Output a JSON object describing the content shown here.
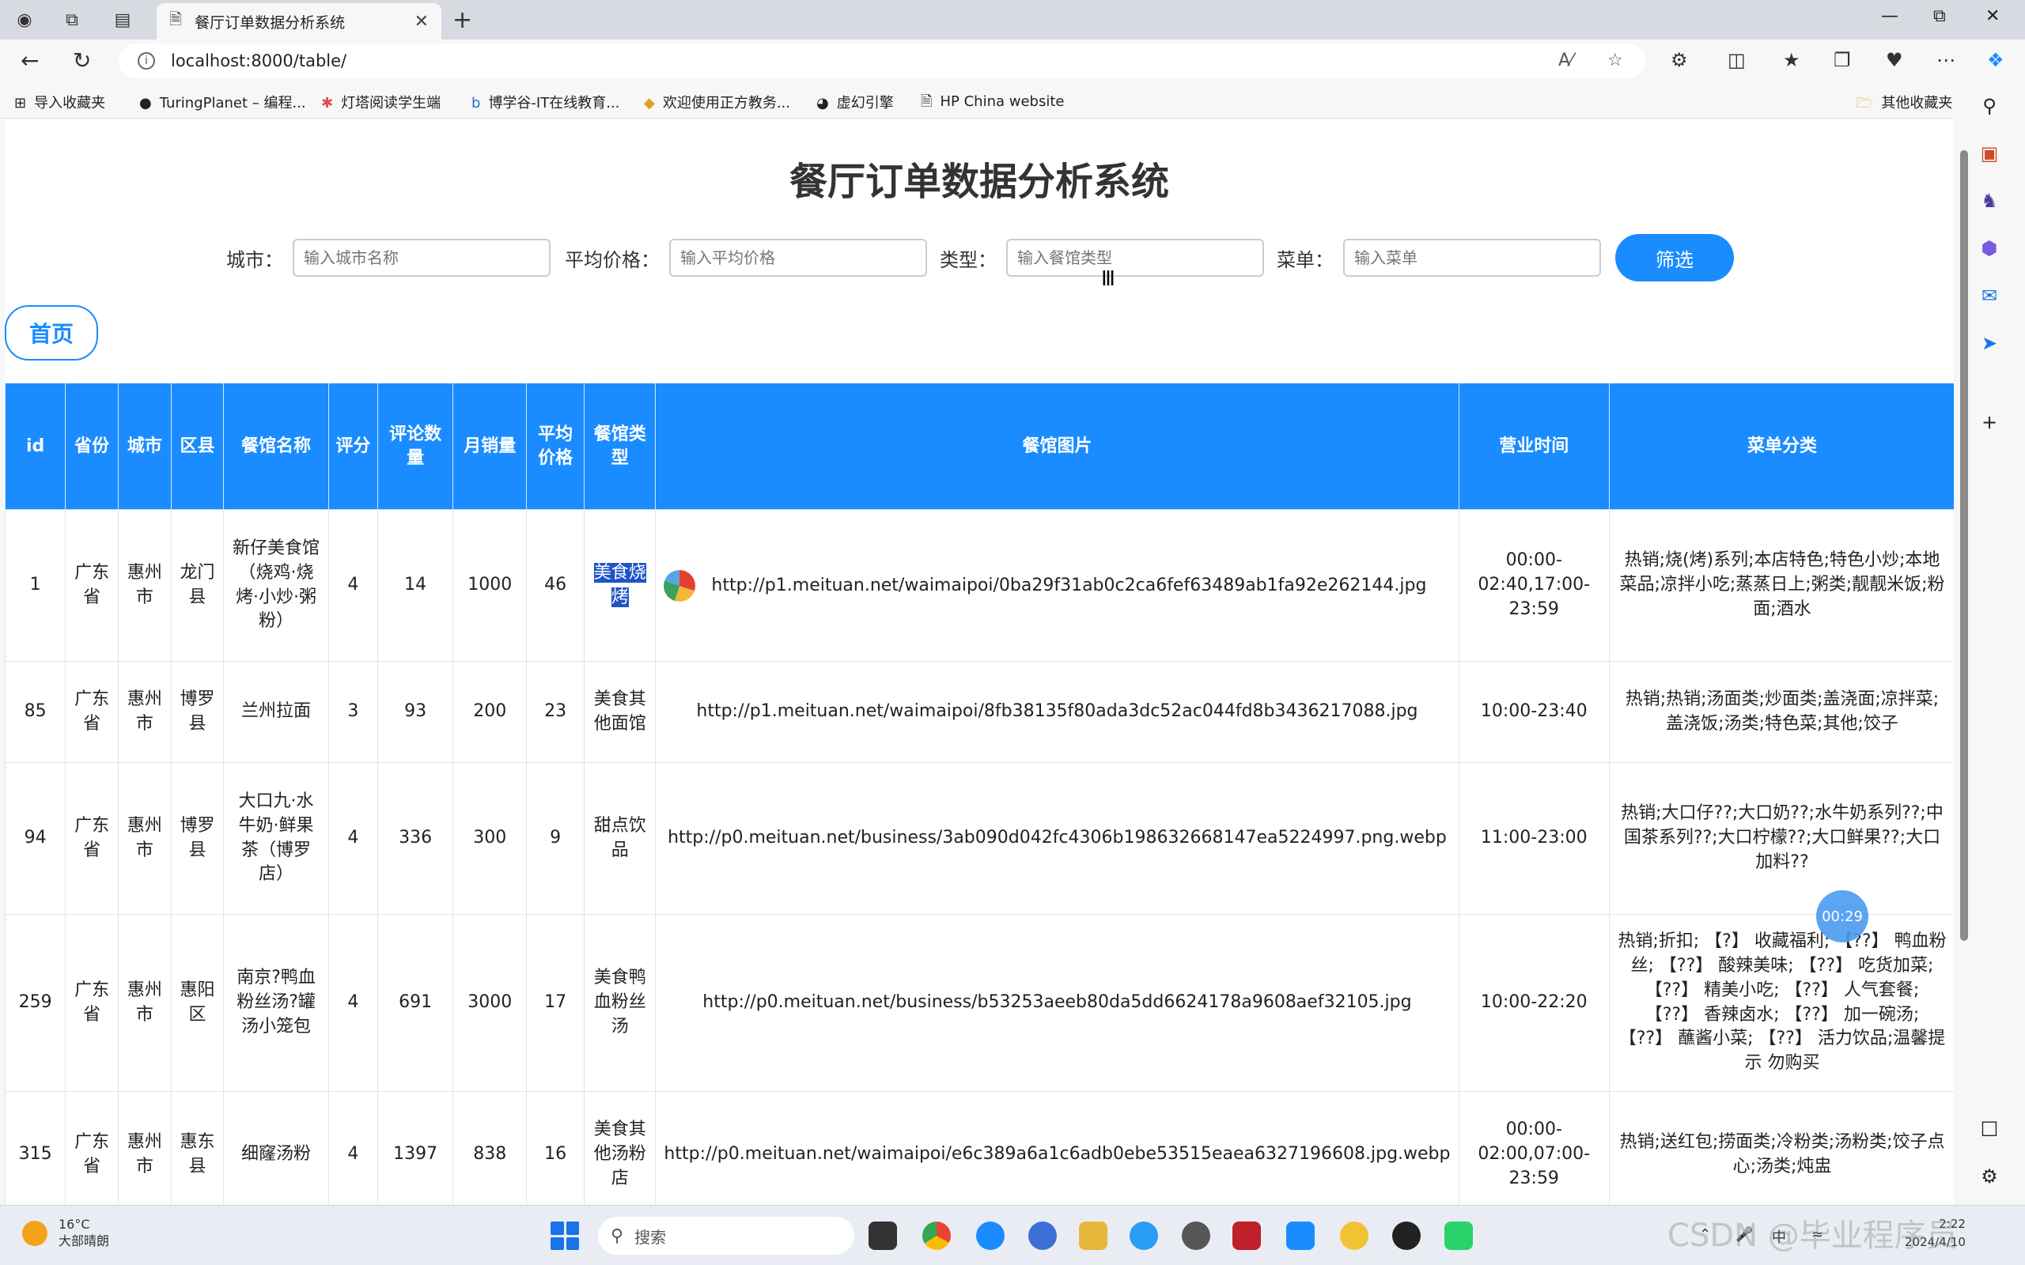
{
  "browser": {
    "tab_title": "餐厅订单数据分析系统",
    "url": "localhost:8000/table/",
    "bookmarks": [
      "导入收藏夹",
      "TuringPlanet – 编程...",
      "灯塔阅读学生端",
      "博学谷-IT在线教育...",
      "欢迎使用正方教务...",
      "虚幻引擎",
      "HP China website"
    ],
    "other_bookmarks": "其他收藏夹"
  },
  "page": {
    "title": "餐厅订单数据分析系统",
    "filters": {
      "city_label": "城市：",
      "city_placeholder": "输入城市名称",
      "price_label": "平均价格：",
      "price_placeholder": "输入平均价格",
      "type_label": "类型：",
      "type_placeholder": "输入餐馆类型",
      "menu_label": "菜单：",
      "menu_placeholder": "输入菜单",
      "button": "筛选"
    },
    "home_button": "首页",
    "timer": "00:29"
  },
  "table": {
    "headers": [
      "id",
      "省份",
      "城市",
      "区县",
      "餐馆名称",
      "评分",
      "评论数量",
      "月销量",
      "平均价格",
      "餐馆类型",
      "餐馆图片",
      "营业时间",
      "菜单分类"
    ],
    "rows": [
      {
        "id": "1",
        "province": "广东省",
        "city": "惠州市",
        "district": "龙门县",
        "name": "新仔美食馆（烧鸡·烧烤·小炒·粥粉）",
        "rating": "4",
        "reviews": "14",
        "monthly": "1000",
        "avg": "46",
        "type": "美食烧烤",
        "image": "http://p1.meituan.net/waimaipoi/0ba29f31ab0c2ca6fef63489ab1fa92e262144.jpg",
        "hours": "00:00-02:40,17:00-23:59",
        "menu": "热销;烧(烤)系列;本店特色;特色小炒;本地菜品;凉拌小吃;蒸蒸日上;粥类;靓靓米饭;粉面;酒水"
      },
      {
        "id": "85",
        "province": "广东省",
        "city": "惠州市",
        "district": "博罗县",
        "name": "兰州拉面",
        "rating": "3",
        "reviews": "93",
        "monthly": "200",
        "avg": "23",
        "type": "美食其他面馆",
        "image": "http://p1.meituan.net/waimaipoi/8fb38135f80ada3dc52ac044fd8b3436217088.jpg",
        "hours": "10:00-23:40",
        "menu": "热销;热销;汤面类;炒面类;盖浇面;凉拌菜;盖浇饭;汤类;特色菜;其他;饺子"
      },
      {
        "id": "94",
        "province": "广东省",
        "city": "惠州市",
        "district": "博罗县",
        "name": "大口九·水牛奶·鲜果茶（博罗店）",
        "rating": "4",
        "reviews": "336",
        "monthly": "300",
        "avg": "9",
        "type": "甜点饮品",
        "image": "http://p0.meituan.net/business/3ab090d042fc4306b198632668147ea5224997.png.webp",
        "hours": "11:00-23:00",
        "menu": "热销;大口仔??;大口奶??;水牛奶系列??;中国茶系列??;大口柠檬??;大口鲜果??;大口加料??"
      },
      {
        "id": "259",
        "province": "广东省",
        "city": "惠州市",
        "district": "惠阳区",
        "name": "南京?鸭血粉丝汤?罐汤小笼包",
        "rating": "4",
        "reviews": "691",
        "monthly": "3000",
        "avg": "17",
        "type": "美食鸭血粉丝汤",
        "image": "http://p0.meituan.net/business/b53253aeeb80da5dd6624178a9608aef32105.jpg",
        "hours": "10:00-22:20",
        "menu": "热销;折扣; 【?】 收藏福利; 【??】 鸭血粉丝; 【??】 酸辣美味; 【??】 吃货加菜; 【??】 精美小吃; 【??】 人气套餐; 【??】 香辣卤水; 【??】 加一碗汤; 【??】 蘸酱小菜; 【??】 活力饮品;温馨提示 勿购买"
      },
      {
        "id": "315",
        "province": "广东省",
        "city": "惠州市",
        "district": "惠东县",
        "name": "细窿汤粉",
        "rating": "4",
        "reviews": "1397",
        "monthly": "838",
        "avg": "16",
        "type": "美食其他汤粉店",
        "image": "http://p0.meituan.net/waimaipoi/e6c389a6a1c6adb0ebe53515eaea6327196608.jpg.webp",
        "hours": "00:00-02:00,07:00-23:59",
        "menu": "热销;送红包;捞面类;冷粉类;汤粉类;饺子点心;汤类;炖盅"
      }
    ]
  },
  "taskbar": {
    "temp": "16°C",
    "weather": "大部晴朗",
    "search": "搜索",
    "ime": "中",
    "time": "2:22",
    "date": "2024/4/10"
  },
  "watermark": "CSDN @毕业程序员"
}
